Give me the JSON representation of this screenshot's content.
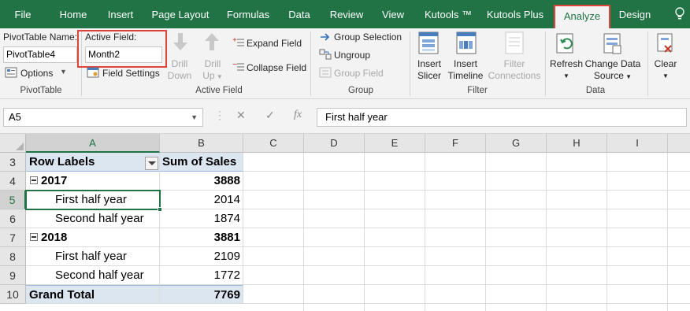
{
  "menu": {
    "tabs": [
      "File",
      "Home",
      "Insert",
      "Page Layout",
      "Formulas",
      "Data",
      "Review",
      "View",
      "Kutools ™",
      "Kutools Plus",
      "Analyze",
      "Design"
    ],
    "active_tab": "Analyze"
  },
  "ribbon": {
    "pivottable": {
      "name_label": "PivotTable Name:",
      "name_value": "PivotTable4",
      "options_label": "Options",
      "group_label": "PivotTable"
    },
    "active_field": {
      "field_label": "Active Field:",
      "field_value": "Month2",
      "settings_label": "Field Settings",
      "drill_down": [
        "Drill",
        "Down"
      ],
      "drill_up": [
        "Drill",
        "Up"
      ],
      "expand_label": "Expand Field",
      "collapse_label": "Collapse Field",
      "group_label": "Active Field"
    },
    "group": {
      "group_selection": "Group Selection",
      "ungroup": "Ungroup",
      "group_field": "Group Field",
      "group_label": "Group"
    },
    "filter": {
      "insert_slicer": [
        "Insert",
        "Slicer"
      ],
      "insert_timeline": [
        "Insert",
        "Timeline"
      ],
      "filter_connections": [
        "Filter",
        "Connections"
      ],
      "group_label": "Filter"
    },
    "data": {
      "refresh": "Refresh",
      "change_source": [
        "Change Data",
        "Source"
      ],
      "group_label": "Data"
    },
    "actions": {
      "clear": "Clear"
    }
  },
  "formula_bar": {
    "name_box": "A5",
    "formula": "First half year"
  },
  "sheet": {
    "columns": [
      "A",
      "B",
      "C",
      "D",
      "E",
      "F",
      "G",
      "H",
      "I"
    ],
    "rows": [
      "3",
      "4",
      "5",
      "6",
      "7",
      "8",
      "9",
      "10"
    ],
    "row3": {
      "a": "Row Labels",
      "b": "Sum of Sales"
    },
    "row4": {
      "a": "2017",
      "b": "3888"
    },
    "row5": {
      "a": "First half year",
      "b": "2014"
    },
    "row6": {
      "a": "Second half year",
      "b": "1874"
    },
    "row7": {
      "a": "2018",
      "b": "3881"
    },
    "row8": {
      "a": "First half year",
      "b": "2109"
    },
    "row9": {
      "a": "Second half year",
      "b": "1772"
    },
    "row10": {
      "a": "Grand Total",
      "b": "7769"
    }
  },
  "colors": {
    "excel_green": "#217346",
    "highlight_red": "#e0453d",
    "pivot_band": "#dce6f1"
  }
}
